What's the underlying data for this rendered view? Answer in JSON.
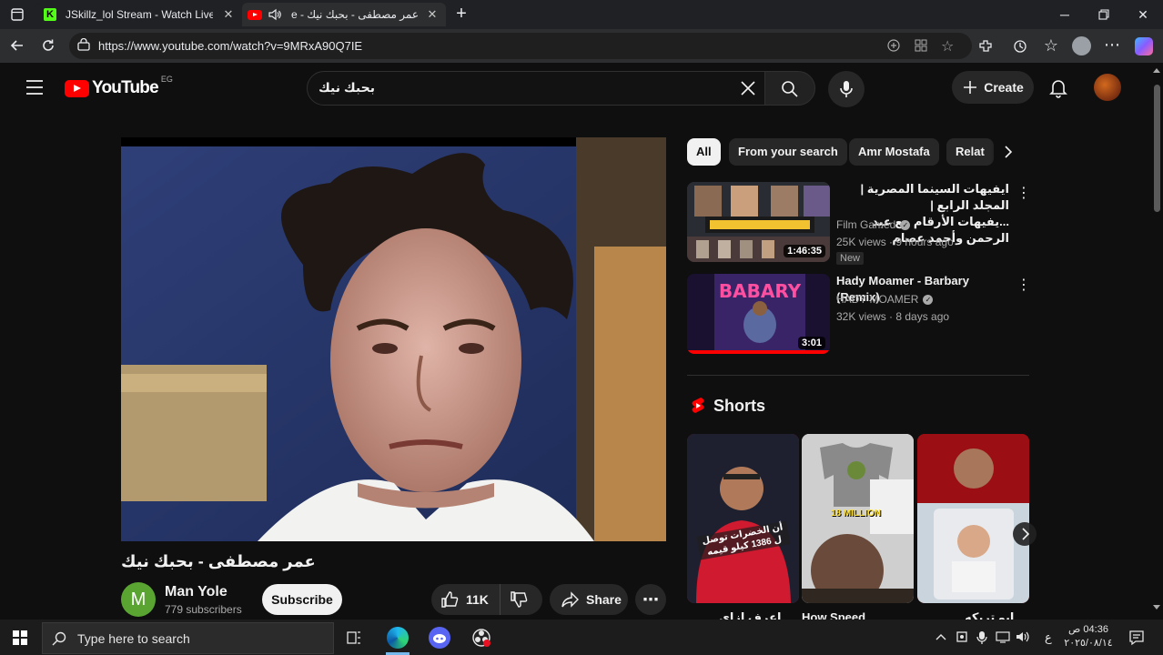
{
  "browser": {
    "tabs": [
      {
        "title": "JSkillz_lol Stream - Watch Live on",
        "active": false
      },
      {
        "title": "عمر مصطفى - بحبك نيك - YouTube",
        "active": true
      }
    ],
    "new_tab_symbol": "+",
    "url": "https://www.youtube.com/watch?v=9MRxA90Q7IE"
  },
  "youtube": {
    "logo_text": "YouTube",
    "region": "EG",
    "search_query": "بحبك نيك",
    "create_label": "Create",
    "chips": [
      {
        "label": "All",
        "active": true
      },
      {
        "label": "From your search",
        "active": false
      },
      {
        "label": "Amr Mostafa",
        "active": false
      },
      {
        "label": "Relat",
        "active": false
      }
    ],
    "video": {
      "title": "عمر مصطفى - بحبك نيك",
      "channel": "Man Yole",
      "channel_initial": "M",
      "subscribers": "779 subscribers",
      "subscribe_label": "Subscribe",
      "likes": "11K",
      "share_label": "Share"
    },
    "related": [
      {
        "title_line1": "ايفيهات السينما المصرية | المجلد الرابع |",
        "title_line2": "...يفيهات الأرقام مع عبد الرحمن وأحمد عصام",
        "channel": "Film Gamed",
        "meta": "25K views · 9 hours ago",
        "badge": "New",
        "duration": "1:46:35"
      },
      {
        "title_line1": "Hady Moamer - Barbary (Remix)",
        "title_line2": "",
        "channel": "HADY MOAMER",
        "meta": "32K views · 8 days ago",
        "badge": "",
        "duration": "3:01"
      }
    ],
    "shorts_heading": "Shorts",
    "shorts": [
      {
        "overlay": "أن الخضرات توصل ل 1386 كيلو قيمه",
        "bottom_title": "...اعرف ازاي"
      },
      {
        "overlay": "18 MILLION",
        "bottom_title": "How Speed"
      },
      {
        "overlay": "",
        "bottom_title": "...ابو تريكه"
      }
    ]
  },
  "taskbar": {
    "search_placeholder": "Type here to search",
    "lang": "ع",
    "time": "04:36 ص",
    "date": "٢٠٢٥/٠٨/١٤"
  },
  "colors": {
    "youtube_red": "#ff0000",
    "chrome_bg": "#202124",
    "page_bg": "#0f0f0f"
  }
}
